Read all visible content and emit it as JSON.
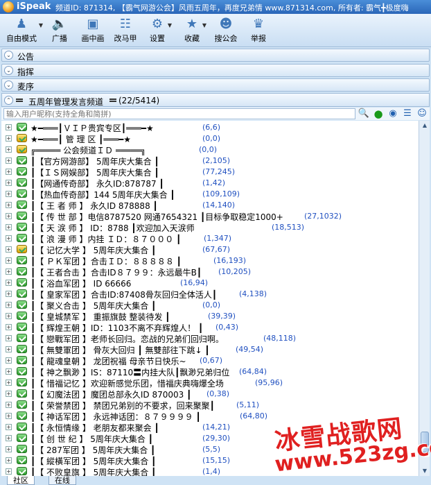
{
  "title_bar": {
    "app_name": "iSpeak",
    "channel_info": "频道ID: 871314, 【霸气网游公会】风雨五周年，再度兄弟情 www.871314.com, 所有者: 霸气╋极度嗨"
  },
  "toolbar": {
    "items": [
      {
        "label": "自由模式",
        "icon": "microphone-person-icon"
      },
      {
        "label": "广播",
        "icon": "speaker-icon"
      },
      {
        "label": "画中画",
        "icon": "picture-in-picture-icon"
      },
      {
        "label": "改马甲",
        "icon": "nickname-card-icon"
      },
      {
        "label": "设置",
        "icon": "gear-icon"
      },
      {
        "label": "收藏",
        "icon": "star-icon"
      },
      {
        "label": "搜公会",
        "icon": "group-search-icon"
      },
      {
        "label": "举报",
        "icon": "police-icon"
      }
    ]
  },
  "panels": [
    {
      "label": "公告"
    },
    {
      "label": "指挥"
    },
    {
      "label": "麦序"
    }
  ],
  "channel_header": {
    "title": "五周年管理发言频道",
    "count": "(22/5414)"
  },
  "search": {
    "placeholder": "输入用户昵称(支持全角和简拼)"
  },
  "tree": [
    {
      "name": "★━═══┃ＶＩＰ贵宾专区┃═══━★",
      "count": "(6,6)",
      "icon": "channel"
    },
    {
      "name": "★━═══┃ 管 理 区 ┃═══━★",
      "count": "(0,0)",
      "icon": "lock"
    },
    {
      "name": "╔═════ 公会频道ＩＤ ═════╗",
      "count": "(0,0)",
      "icon": "lock"
    },
    {
      "name": "┃【官方网游部】   5周年庆大集合   ┃",
      "count": "(2,105)",
      "icon": "channel"
    },
    {
      "name": "┃【ＩＳ网娱部】   5周年庆大集合   ┃",
      "count": "(77,245)",
      "icon": "channel"
    },
    {
      "name": "┃【网通传奇部】   永久ID:878787  ┃",
      "count": "(1,42)",
      "icon": "channel"
    },
    {
      "name": "┃【热血传奇部】144 5周年庆大集合   ┃",
      "count": "(109,109)",
      "icon": "channel"
    },
    {
      "name": "┃【 王 者 师 】   永久ID 878888  ┃",
      "count": "(14,140)",
      "icon": "channel"
    },
    {
      "name": "┃【 传 世 部 】电信8787520 网通7654321  ┃目标争取稳定1000+",
      "count": "(27,1032)",
      "icon": "channel"
    },
    {
      "name": "┃【 天 涙 师 】      ID：8788 ┃欢迎加入天涙师",
      "count": "(18,513)",
      "icon": "channel"
    },
    {
      "name": "┃【 浪 漫 师 】内挂 ＩＤ：８７０００ ┃",
      "count": "(1,347)",
      "icon": "channel"
    },
    {
      "name": "┃【 记忆大学 】   5周年庆大集合   ┃",
      "count": "(67,67)",
      "icon": "lock"
    },
    {
      "name": "┃【 ＰＫ军团 】合击ＩＤ：８８８８８ ┃",
      "count": "(16,193)",
      "icon": "channel"
    },
    {
      "name": "┃【 王者合击 】合击ID８７９９：永远最牛B┃",
      "count": "(10,205)",
      "icon": "channel"
    },
    {
      "name": "┃【 浴血军团 】      ID  66666",
      "count": "(16,94)",
      "icon": "channel"
    },
    {
      "name": "┃【 皇家军团 】合击ID:87408骨灰回归全体活人┃",
      "count": "(4,138)",
      "icon": "channel"
    },
    {
      "name": "┃【 聚义合击 】   5周年庆大集合   ┃",
      "count": "(0,0)",
      "icon": "channel"
    },
    {
      "name": "┃【 皇城禁军 】    重振旗鼓  整装待发  ┃",
      "count": "(39,39)",
      "icon": "channel"
    },
    {
      "name": "┃【 辉煌王朝 】ID：1103不离不弃辉煌人！ ┃",
      "count": "(0,43)",
      "icon": "channel"
    },
    {
      "name": "┃【 戀戰军团 】老师长回归。恋战的兄弟们回归啊。",
      "count": "(48,118)",
      "icon": "channel"
    },
    {
      "name": "┃【 無雙軍团 】    骨灰大回归  ┃ 無雙部往下跳↓ ┃",
      "count": "(49,54)",
      "icon": "channel"
    },
    {
      "name": "┃【 龍魂皇朝 】  龙团祝福 母亲节日快乐~",
      "count": "(0,67)",
      "icon": "channel"
    },
    {
      "name": "┃【 神之飘渺 】IS：87110〓内挂大队┃飘渺兄弟归位",
      "count": "(64,84)",
      "icon": "channel"
    },
    {
      "name": "┃【 惜福记忆 】欢迎新感觉乐团，惜福庆典嗨爆全场",
      "count": "(95,96)",
      "icon": "channel"
    },
    {
      "name": "┃【 幻魔法团 】魔团总部永久ID 870003 ┃",
      "count": "(0,38)",
      "icon": "channel"
    },
    {
      "name": "┃【 荣誉禁团 】  禁团兄弟别的不要求，回来聚聚┃",
      "count": "(5,11)",
      "icon": "channel"
    },
    {
      "name": "┃【 神话军团 】  永远神话团：８７９９９９  ┃",
      "count": "(64,80)",
      "icon": "channel"
    },
    {
      "name": "┃【 永恒情缘 】    老朋友都来聚会  ┃",
      "count": "(14,21)",
      "icon": "channel"
    },
    {
      "name": "┃【 创 世 纪 】   5周年庆大集合   ┃",
      "count": "(29,30)",
      "icon": "channel"
    },
    {
      "name": "┃【 287军团 】   5周年庆大集合   ┃",
      "count": "(5,5)",
      "icon": "channel"
    },
    {
      "name": "┃【 縱橫军团 】   5周年庆大集合   ┃",
      "count": "(15,15)",
      "icon": "channel"
    },
    {
      "name": "┃【 不败皇旗 】   5周年庆大集合   ┃",
      "count": "(1,4)",
      "icon": "channel"
    }
  ],
  "tabs": [
    {
      "label": "社区"
    },
    {
      "label": "在线"
    }
  ],
  "watermark": {
    "title": "冰雪战歌网",
    "url": "www.523zg.com"
  }
}
